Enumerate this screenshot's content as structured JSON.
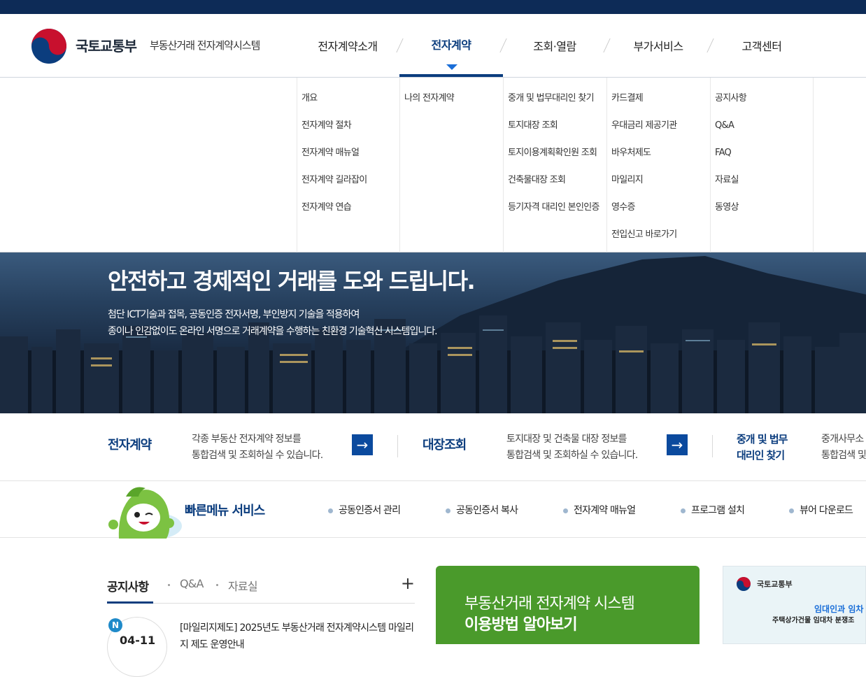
{
  "header": {
    "logo_main": "국토교통부",
    "logo_sub": "부동산거래 전자계약시스템",
    "nav": [
      "전자계약소개",
      "전자계약",
      "조회·열람",
      "부가서비스",
      "고객센터"
    ],
    "active_nav": "전자계약"
  },
  "dropdown": {
    "col1": [
      "개요",
      "전자계약 절차",
      "전자계약 매뉴얼",
      "전자계약 길라잡이",
      "전자계약 연습"
    ],
    "col2": [
      "나의 전자계약"
    ],
    "col3": [
      "중개 및 법무대리인 찾기",
      "토지대장 조회",
      "토지이용계획확인원 조회",
      "건축물대장 조회",
      "등기자격 대리인 본인인증"
    ],
    "col4": [
      "카드결제",
      "우대금리 제공기관",
      "바우처제도",
      "마일리지",
      "영수증",
      "전입신고 바로가기"
    ],
    "col5": [
      "공지사항",
      "Q&A",
      "FAQ",
      "자료실",
      "동영상"
    ]
  },
  "hero": {
    "title": "안전하고 경제적인 거래를 도와 드립니다.",
    "desc1": "첨단 ICT기술과 접목, 공동인증 전자서명, 부인방지 기술을 적용하여",
    "desc2": "종이나 인감없이도 온라인 서명으로 거래계약을 수행하는 친환경 기술혁신 시스템입니다."
  },
  "quick": {
    "items": [
      {
        "title": "전자계약",
        "desc1": "각종 부동산 전자계약 정보를",
        "desc2": "통합검색 및 조회하실 수 있습니다."
      },
      {
        "title": "대장조회",
        "desc1": "토지대장 및 건축물 대장 정보를",
        "desc2": "통합검색 및 조회하실 수 있습니다."
      },
      {
        "title1": "중개 및 법무",
        "title2": "대리인 찾기",
        "desc1": "중개사무소",
        "desc2": "통합검색 및"
      }
    ],
    "arrow": "→"
  },
  "fast": {
    "title": "빠른메뉴 서비스",
    "items": [
      "공동인증서 관리",
      "공동인증서 복사",
      "전자계약 매뉴얼",
      "프로그램 설치",
      "뷰어 다운로드"
    ]
  },
  "notice": {
    "tabs": [
      "공지사항",
      "Q&A",
      "자료실"
    ],
    "plus": "+",
    "badge": "N",
    "date": "04-11",
    "text": "[마일리지제도] 2025년도 부동산거래 전자계약시스템 마일리지 제도 운영안내"
  },
  "guide": {
    "line1": "부동산거래 전자계약 시스템",
    "line2": "이용방법 알아보기"
  },
  "banner": {
    "org": "국토교통부",
    "t1": "임대인과 임차",
    "t2": "주택상가건물 임대차 분쟁조"
  },
  "colors": {
    "navy": "#0b3d7e",
    "topbar": "#0d2b57",
    "green": "#4a9a2b",
    "accent": "#1a6ed8"
  }
}
